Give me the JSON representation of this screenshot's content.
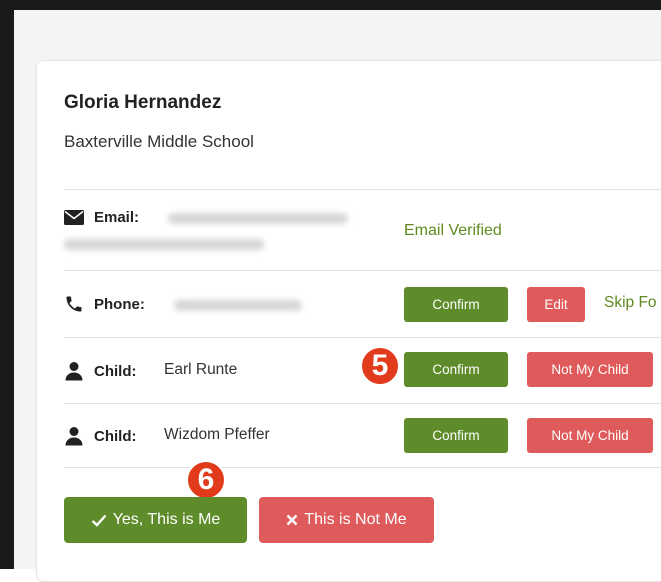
{
  "profile": {
    "name": "Gloria Hernandez",
    "school": "Baxterville Middle School"
  },
  "email": {
    "label": "Email:",
    "status": "Email Verified"
  },
  "phone": {
    "label": "Phone:",
    "confirm_label": "Confirm",
    "edit_label": "Edit",
    "skip_label": "Skip Fo"
  },
  "children": [
    {
      "label": "Child:",
      "name": "Earl Runte",
      "confirm_label": "Confirm",
      "reject_label": "Not My Child"
    },
    {
      "label": "Child:",
      "name": "Wizdom Pfeffer",
      "confirm_label": "Confirm",
      "reject_label": "Not My Child"
    }
  ],
  "actions": {
    "yes_label": "Yes, This is Me",
    "no_label": "This is Not Me"
  },
  "callouts": {
    "step5": "5",
    "step6": "6"
  },
  "colors": {
    "green": "#5e8c2a",
    "red": "#df5a5a",
    "verified_text": "#5f8a1f",
    "callout": "#e23b1c"
  },
  "icons": {
    "email": "envelope-icon",
    "phone": "phone-icon",
    "child": "person-icon",
    "check": "check-icon",
    "cross": "x-icon"
  }
}
